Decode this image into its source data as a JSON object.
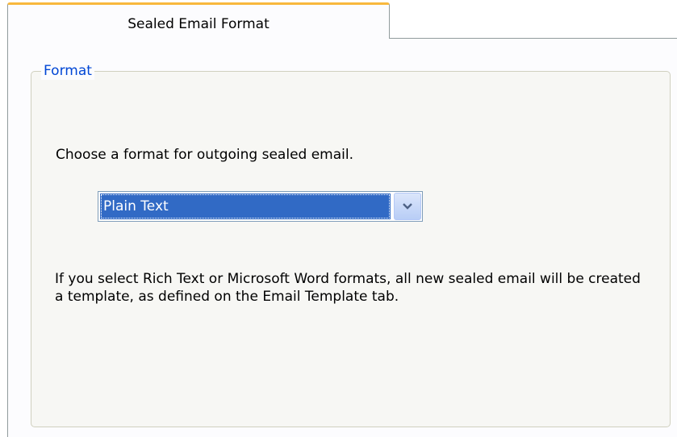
{
  "tab": {
    "label": "Sealed Email Format"
  },
  "format_group": {
    "legend": "Format",
    "instruction": "Choose a format for outgoing sealed email.",
    "format_select": {
      "selected": "Plain Text",
      "icon": "chevron-down-icon"
    },
    "note": "If you select Rich Text or Microsoft Word formats, all new sealed email will be created a template, as defined on the Email Template tab."
  },
  "colors": {
    "legend": "#0046d5",
    "selection": "#316ac5",
    "tab_accent": "#f8b83d"
  }
}
